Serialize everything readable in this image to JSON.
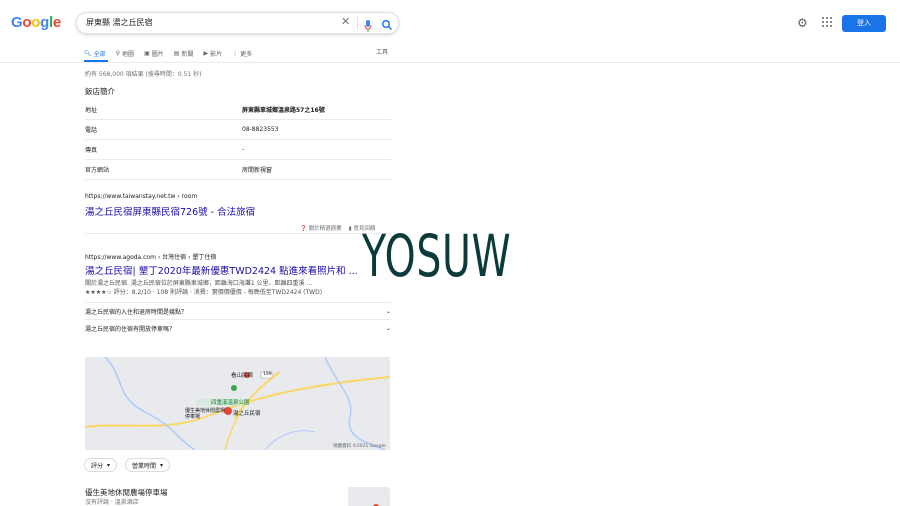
{
  "logo": [
    "G",
    "o",
    "o",
    "g",
    "l",
    "e"
  ],
  "search": {
    "query": "屏東縣 湯之丘民宿"
  },
  "header": {
    "signin_label": "登入"
  },
  "tabs": [
    {
      "label": "全部",
      "icon": "search-icon"
    },
    {
      "label": "地圖",
      "icon": "map-pin-icon"
    },
    {
      "label": "圖片",
      "icon": "image-icon"
    },
    {
      "label": "新聞",
      "icon": "news-icon"
    },
    {
      "label": "影片",
      "icon": "video-icon"
    },
    {
      "label": "更多",
      "icon": "more-dots-icon"
    }
  ],
  "tools_label": "工具",
  "stats": "約有 568,000 項結果 (搜尋時間：0.51 秒)",
  "knowledge": {
    "title": "飯店簡介",
    "rows": [
      {
        "key": "地址",
        "value": "屏東縣車城鄉溫泉路57之16號"
      },
      {
        "key": "電話",
        "value": "08-8823553"
      },
      {
        "key": "傳真",
        "value": "-"
      },
      {
        "key": "官方網站",
        "value": "房間新視窗"
      }
    ]
  },
  "result1": {
    "url": "https://www.taiwanstay.net.tw › room",
    "title": "湯之丘民宿屏東縣民宿726號 - 合法旅宿"
  },
  "feedback": {
    "about": "關於精選摘要",
    "fb": "意見回饋"
  },
  "result2": {
    "url": "https://www.agoda.com › 台灣住宿 › 墾丁住宿",
    "title": "湯之丘民宿| 墾丁2020年最新優惠TWD2424 點進來看照片和 ...",
    "snippet": "關於湯之丘民宿. 湯之丘民宿位於屏東縣車城鄉，距離海口海灘1 公里、距離四重溪 ...",
    "rating_line": "★★★★☆ 評分：8.2/10 · 108 則評論 · 消費：實價價優價 - 每晚低至TWD2424 (TWD)"
  },
  "faq": [
    "湯之丘民宿的入住和退房時間是幾點？",
    "湯之丘民宿的住宿有開放停車嗎？"
  ],
  "map": {
    "labels": [
      "看山民宿",
      "四重溪溫泉公園",
      "優生美地休閒農場停車場",
      "湯之丘民宿"
    ],
    "road": "199",
    "copyright": "地圖資料 ©2021 Google"
  },
  "chips": [
    "評分",
    "營業時間"
  ],
  "local": {
    "name": "優生美地休閒農場停車場",
    "reviews": "沒有評論 · 溫泉酒店"
  },
  "watermark": "YOSUW",
  "colors": {
    "link": "#1a0dab",
    "accent": "#1a73e8"
  }
}
